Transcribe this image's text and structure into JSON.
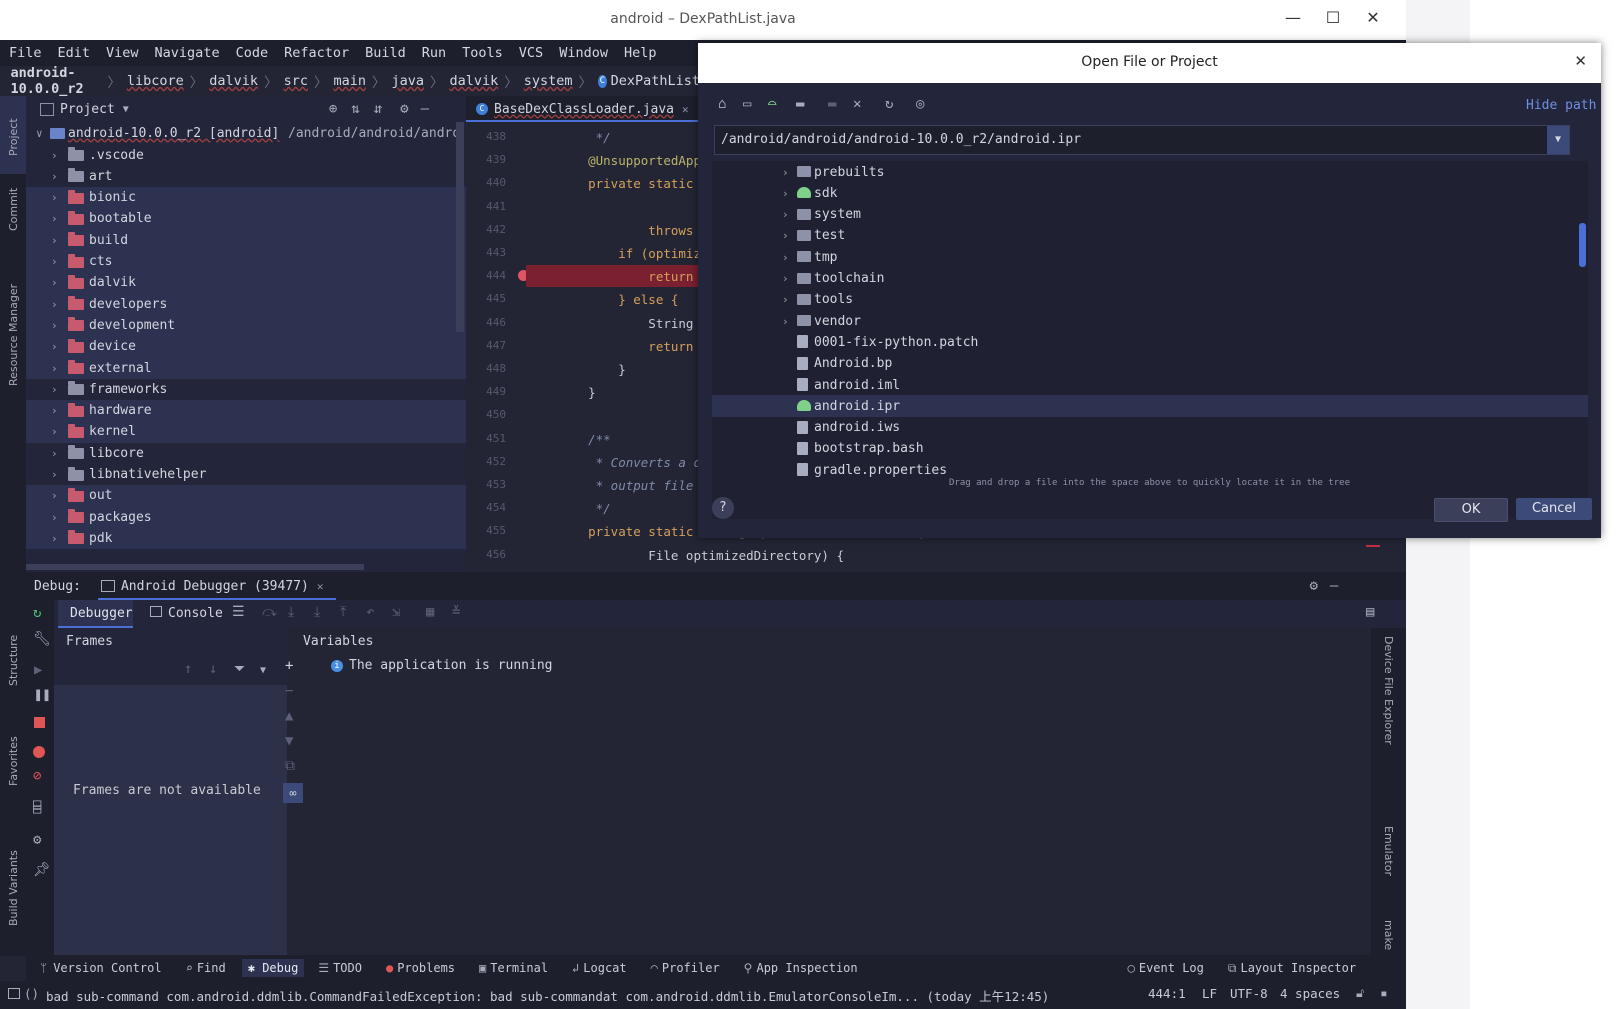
{
  "window": {
    "title": "android – DexPathList.java"
  },
  "menu": [
    "File",
    "Edit",
    "View",
    "Navigate",
    "Code",
    "Refactor",
    "Build",
    "Run",
    "Tools",
    "VCS",
    "Window",
    "Help"
  ],
  "breadcrumb": [
    "android-10.0.0_r2",
    "libcore",
    "dalvik",
    "src",
    "main",
    "java",
    "dalvik",
    "system",
    "DexPathList"
  ],
  "project": {
    "header": "Project",
    "root_name": "android-10.0.0_r2 [android]",
    "root_path": "/android/android/andro",
    "items": [
      {
        "name": ".vscode",
        "kind": "normal"
      },
      {
        "name": "art",
        "kind": "normal"
      },
      {
        "name": "bionic",
        "kind": "red"
      },
      {
        "name": "bootable",
        "kind": "red"
      },
      {
        "name": "build",
        "kind": "red"
      },
      {
        "name": "cts",
        "kind": "red"
      },
      {
        "name": "dalvik",
        "kind": "red"
      },
      {
        "name": "developers",
        "kind": "red"
      },
      {
        "name": "development",
        "kind": "red"
      },
      {
        "name": "device",
        "kind": "red"
      },
      {
        "name": "external",
        "kind": "red"
      },
      {
        "name": "frameworks",
        "kind": "normal"
      },
      {
        "name": "hardware",
        "kind": "red"
      },
      {
        "name": "kernel",
        "kind": "red"
      },
      {
        "name": "libcore",
        "kind": "normal"
      },
      {
        "name": "libnativehelper",
        "kind": "normal"
      },
      {
        "name": "out",
        "kind": "red"
      },
      {
        "name": "packages",
        "kind": "red"
      },
      {
        "name": "pdk",
        "kind": "red"
      }
    ]
  },
  "editor": {
    "tab": "BaseDexClassLoader.java",
    "lines": [
      {
        "n": "438",
        "code": "     */"
      },
      {
        "n": "439",
        "code": "    @UnsupportedAppUsa"
      },
      {
        "n": "440",
        "code": "    private static Dex"
      },
      {
        "n": "441",
        "code": ""
      },
      {
        "n": "442",
        "code": "            throws IOE"
      },
      {
        "n": "443",
        "code": "        if (optimizedD"
      },
      {
        "n": "444",
        "code": "            return new"
      },
      {
        "n": "445",
        "code": "        } else {"
      },
      {
        "n": "446",
        "code": "            String opt"
      },
      {
        "n": "447",
        "code": "            return Dex"
      },
      {
        "n": "448",
        "code": "        }"
      },
      {
        "n": "449",
        "code": "    }"
      },
      {
        "n": "450",
        "code": ""
      },
      {
        "n": "451",
        "code": "    /**"
      },
      {
        "n": "452",
        "code": "     * Converts a dex/"
      },
      {
        "n": "453",
        "code": "     * output file pat"
      },
      {
        "n": "454",
        "code": "     */"
      },
      {
        "n": "455",
        "code": "    private static String optimizedPathFor(File path,"
      },
      {
        "n": "456",
        "code": "            File optimizedDirectory) {"
      }
    ]
  },
  "dialog": {
    "title": "Open File or Project",
    "hide_path": "Hide path",
    "path": "/android/android/android-10.0.0_r2/android.ipr",
    "items": [
      {
        "name": "prebuilts",
        "type": "folder"
      },
      {
        "name": "sdk",
        "type": "android"
      },
      {
        "name": "system",
        "type": "folder"
      },
      {
        "name": "test",
        "type": "folder"
      },
      {
        "name": "tmp",
        "type": "folder"
      },
      {
        "name": "toolchain",
        "type": "folder"
      },
      {
        "name": "tools",
        "type": "folder"
      },
      {
        "name": "vendor",
        "type": "folder"
      },
      {
        "name": "0001-fix-python.patch",
        "type": "file"
      },
      {
        "name": "Android.bp",
        "type": "file"
      },
      {
        "name": "android.iml",
        "type": "file"
      },
      {
        "name": "android.ipr",
        "type": "android"
      },
      {
        "name": "android.iws",
        "type": "file"
      },
      {
        "name": "bootstrap.bash",
        "type": "file"
      },
      {
        "name": "gradle.properties",
        "type": "file"
      }
    ],
    "hint": "Drag and drop a file into the space above to quickly locate it in the tree",
    "ok": "OK",
    "cancel": "Cancel",
    "help": "?"
  },
  "debug": {
    "label": "Debug:",
    "tab": "Android Debugger (39477)",
    "debugger_tab": "Debugger",
    "console_tab": "Console",
    "frames_title": "Frames",
    "frames_empty": "Frames are not available",
    "variables_title": "Variables",
    "variables_msg": "The application is running"
  },
  "left_strip": [
    "Project",
    "Commit",
    "Resource Manager",
    "Structure",
    "Favorites",
    "Build Variants"
  ],
  "right_strip": [
    "Device File Explorer",
    "Emulator",
    "make"
  ],
  "bottom_tools": [
    "Version Control",
    "Find",
    "Debug",
    "TODO",
    "Problems",
    "Terminal",
    "Logcat",
    "Profiler",
    "App Inspection"
  ],
  "bottom_right": [
    "Event Log",
    "Layout Inspector"
  ],
  "status": {
    "message": "bad sub-command com.android.ddmlib.CommandFailedException: bad sub-commandat com.android.ddmlib.EmulatorConsoleIm... (today 上午12:45)",
    "position": "444:1",
    "line_sep": "LF",
    "encoding": "UTF-8",
    "indent": "4 spaces"
  },
  "colors": {
    "accent": "#4a6fd6",
    "red_folder": "#c85a6e",
    "folder": "#8e92a8",
    "android": "#7fd18a",
    "breakpoint": "#7a2030"
  }
}
